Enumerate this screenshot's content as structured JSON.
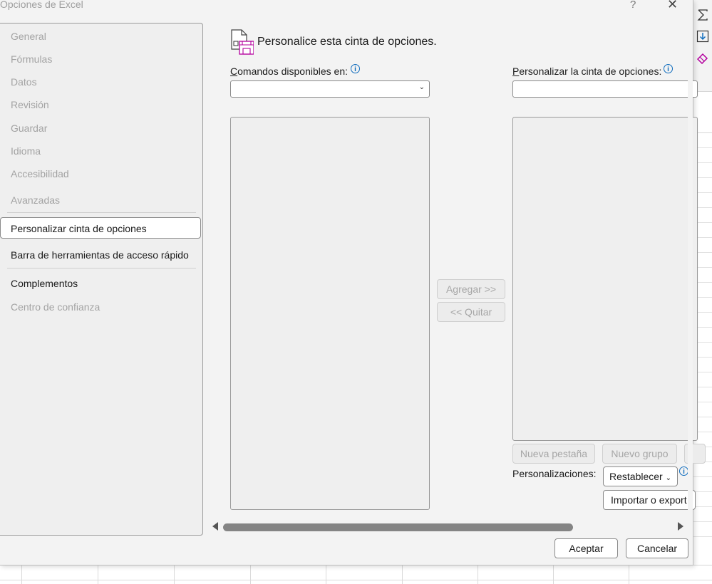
{
  "window": {
    "title": "Opciones de Excel",
    "help": "?",
    "close": "✕"
  },
  "nav": {
    "items": [
      {
        "label": "General",
        "active": false
      },
      {
        "label": "Fórmulas",
        "active": false
      },
      {
        "label": "Datos",
        "active": false
      },
      {
        "label": "Revisión",
        "active": false
      },
      {
        "label": "Guardar",
        "active": false
      },
      {
        "label": "Idioma",
        "active": false
      },
      {
        "label": "Accesibilidad",
        "active": false
      },
      {
        "label": "Avanzadas",
        "active": false
      },
      {
        "label": "Personalizar cinta de opciones",
        "active": true,
        "selected": true
      },
      {
        "label": "Barra de herramientas de acceso rápido",
        "active": true
      },
      {
        "label": "Complementos",
        "active": true
      },
      {
        "label": "Centro de confianza",
        "active": false
      }
    ]
  },
  "main": {
    "title": "Personalice esta cinta de opciones.",
    "commands_label_underlined": "C",
    "commands_label_rest": "omandos disponibles en:",
    "customize_label_underlined": "P",
    "customize_label_rest": "ersonalizar la cinta de opciones:",
    "commands_select_value": "",
    "customize_select_value": "",
    "add_button": "Agregar >>",
    "remove_button": "<< Quitar",
    "new_tab_button": "Nueva pestaña",
    "new_group_button": "Nuevo grupo",
    "customizations_label": "Personalizaciones:",
    "reset_button": "Restablecer",
    "import_export_button": "Importar o export"
  },
  "footer": {
    "ok_button": "Aceptar",
    "cancel_button": "Cancelar"
  },
  "colors": {
    "info_blue": "#0f6cbd",
    "ribbon_icon_purple": "#b4009e"
  }
}
